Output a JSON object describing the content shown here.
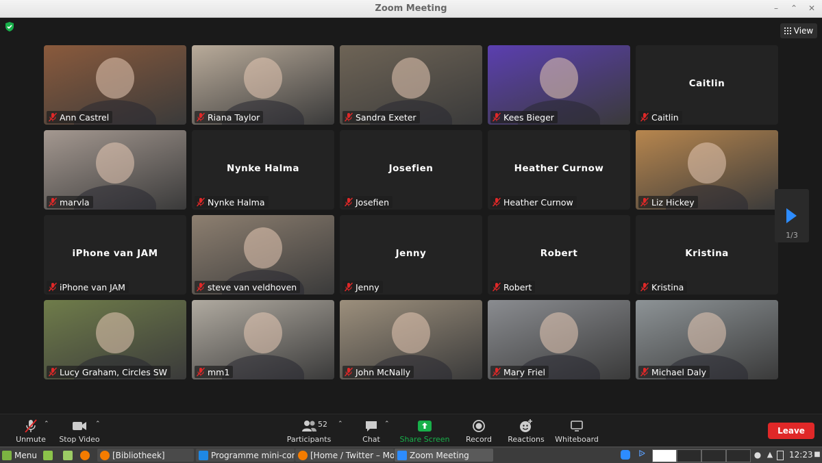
{
  "window": {
    "title": "Zoom Meeting"
  },
  "view_button": {
    "label": "View"
  },
  "pager": {
    "count": "1/3"
  },
  "participants": [
    {
      "name": "Ann Castrel",
      "video": true,
      "bg": "#8a5a3c"
    },
    {
      "name": "Riana Taylor",
      "video": true,
      "bg": "#b9ab9a"
    },
    {
      "name": "Sandra Exeter",
      "video": true,
      "bg": "#6e6456"
    },
    {
      "name": "Kees Bieger",
      "video": true,
      "bg": "#5b3fb0"
    },
    {
      "name": "Caitlin",
      "video": false
    },
    {
      "name": "marvla",
      "video": true,
      "bg": "#a49890"
    },
    {
      "name": "Nynke Halma",
      "video": false
    },
    {
      "name": "Josefien",
      "video": false
    },
    {
      "name": "Heather Curnow",
      "video": false
    },
    {
      "name": "Liz Hickey",
      "video": true,
      "bg": "#b7864e"
    },
    {
      "name": "iPhone van JAM",
      "video": false
    },
    {
      "name": "steve van veldhoven",
      "video": true,
      "bg": "#8d7f70"
    },
    {
      "name": "Jenny",
      "video": false
    },
    {
      "name": "Robert",
      "video": false
    },
    {
      "name": "Kristina",
      "video": false
    },
    {
      "name": "Lucy Graham, Circles SW",
      "video": true,
      "bg": "#6f7c4a"
    },
    {
      "name": "mm1",
      "video": true,
      "bg": "#b0aaa0"
    },
    {
      "name": "John McNally",
      "video": true,
      "bg": "#9c8f7c"
    },
    {
      "name": "Mary Friel",
      "video": true,
      "bg": "#8a8c90"
    },
    {
      "name": "Michael Daly",
      "video": true,
      "bg": "#8d9396"
    }
  ],
  "toolbar": {
    "unmute": "Unmute",
    "stop_video": "Stop Video",
    "participants": "Participants",
    "participants_count": "52",
    "chat": "Chat",
    "share_screen": "Share Screen",
    "record": "Record",
    "reactions": "Reactions",
    "whiteboard": "Whiteboard",
    "leave": "Leave"
  },
  "taskbar": {
    "menu": "Menu",
    "apps": [
      "[Bibliotheek]",
      "Programme mini-con...",
      "[Home / Twitter – Mo...",
      "Zoom Meeting"
    ],
    "clock": "12:23"
  },
  "colors": {
    "accent_green": "#18b04a",
    "accent_blue": "#2d8cff",
    "leave_red": "#e02828",
    "mute_red": "#e02828"
  }
}
